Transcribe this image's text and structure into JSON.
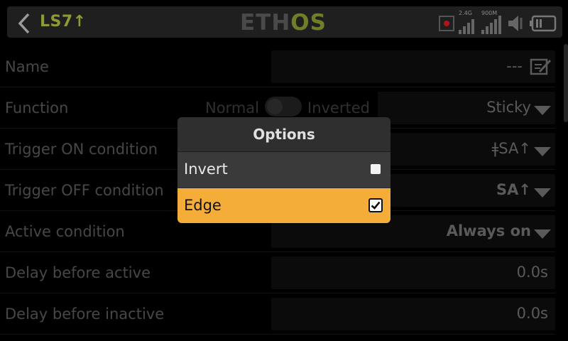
{
  "header": {
    "breadcrumb": "LS7↑",
    "logo_part1": "ETH",
    "logo_part2": "OS",
    "rf_label_left": "2.4G",
    "rf_label_right": "900M"
  },
  "rows": {
    "name": {
      "label": "Name",
      "value": "---"
    },
    "function": {
      "label": "Function",
      "toggle_left": "Normal",
      "toggle_right": "Inverted",
      "value": "Sticky"
    },
    "trigger_on": {
      "label": "Trigger ON condition",
      "value": "ǂSA↑"
    },
    "trigger_off": {
      "label": "Trigger OFF condition",
      "value": "SA↑"
    },
    "active_condition": {
      "label": "Active condition",
      "value": "Always on"
    },
    "delay_active": {
      "label": "Delay before active",
      "value": "0.0s"
    },
    "delay_inactive": {
      "label": "Delay before inactive",
      "value": "0.0s"
    }
  },
  "dialog": {
    "title": "Options",
    "options": [
      {
        "label": "Invert",
        "checked": false
      },
      {
        "label": "Edge",
        "checked": true
      }
    ],
    "highlight_color": "#f5ad3a"
  },
  "colors": {
    "crumb": "#8f9a34",
    "logo_accent": "#6f7f28"
  },
  "icons": [
    "back-chevron-icon",
    "edit-icon",
    "record-icon",
    "signal-bars-icon",
    "speaker-icon",
    "battery-icon"
  ]
}
